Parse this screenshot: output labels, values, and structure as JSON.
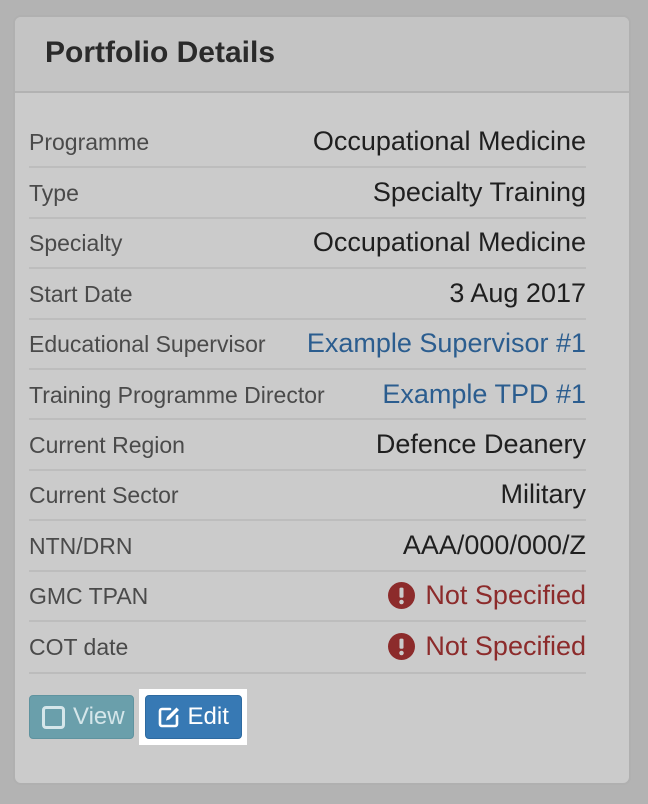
{
  "panel": {
    "title": "Portfolio Details"
  },
  "details": [
    {
      "label": "Programme",
      "value": "Occupational Medicine",
      "kind": "text"
    },
    {
      "label": "Type",
      "value": "Specialty Training",
      "kind": "text"
    },
    {
      "label": "Specialty",
      "value": "Occupational Medicine",
      "kind": "text"
    },
    {
      "label": "Start Date",
      "value": "3 Aug 2017",
      "kind": "text"
    },
    {
      "label": "Educational Supervisor",
      "value": "Example Supervisor #1",
      "kind": "link"
    },
    {
      "label": "Training Programme Director",
      "value": "Example TPD #1",
      "kind": "link"
    },
    {
      "label": "Current Region",
      "value": "Defence Deanery",
      "kind": "text"
    },
    {
      "label": "Current Sector",
      "value": "Military",
      "kind": "text"
    },
    {
      "label": "NTN/DRN",
      "value": "AAA/000/000/Z",
      "kind": "text"
    },
    {
      "label": "GMC TPAN",
      "value": "Not Specified",
      "kind": "warning",
      "icon": "exclamation-circle-icon"
    },
    {
      "label": "COT date",
      "value": "Not Specified",
      "kind": "warning",
      "icon": "exclamation-circle-icon"
    }
  ],
  "actions": {
    "view_label": "View",
    "view_icon": "square-icon",
    "edit_label": "Edit",
    "edit_icon": "pencil-square-icon"
  },
  "colors": {
    "link": "#2b5d8f",
    "warning": "#8c2b2b",
    "view_button": "#6a9fab",
    "edit_button": "#3779b4"
  }
}
